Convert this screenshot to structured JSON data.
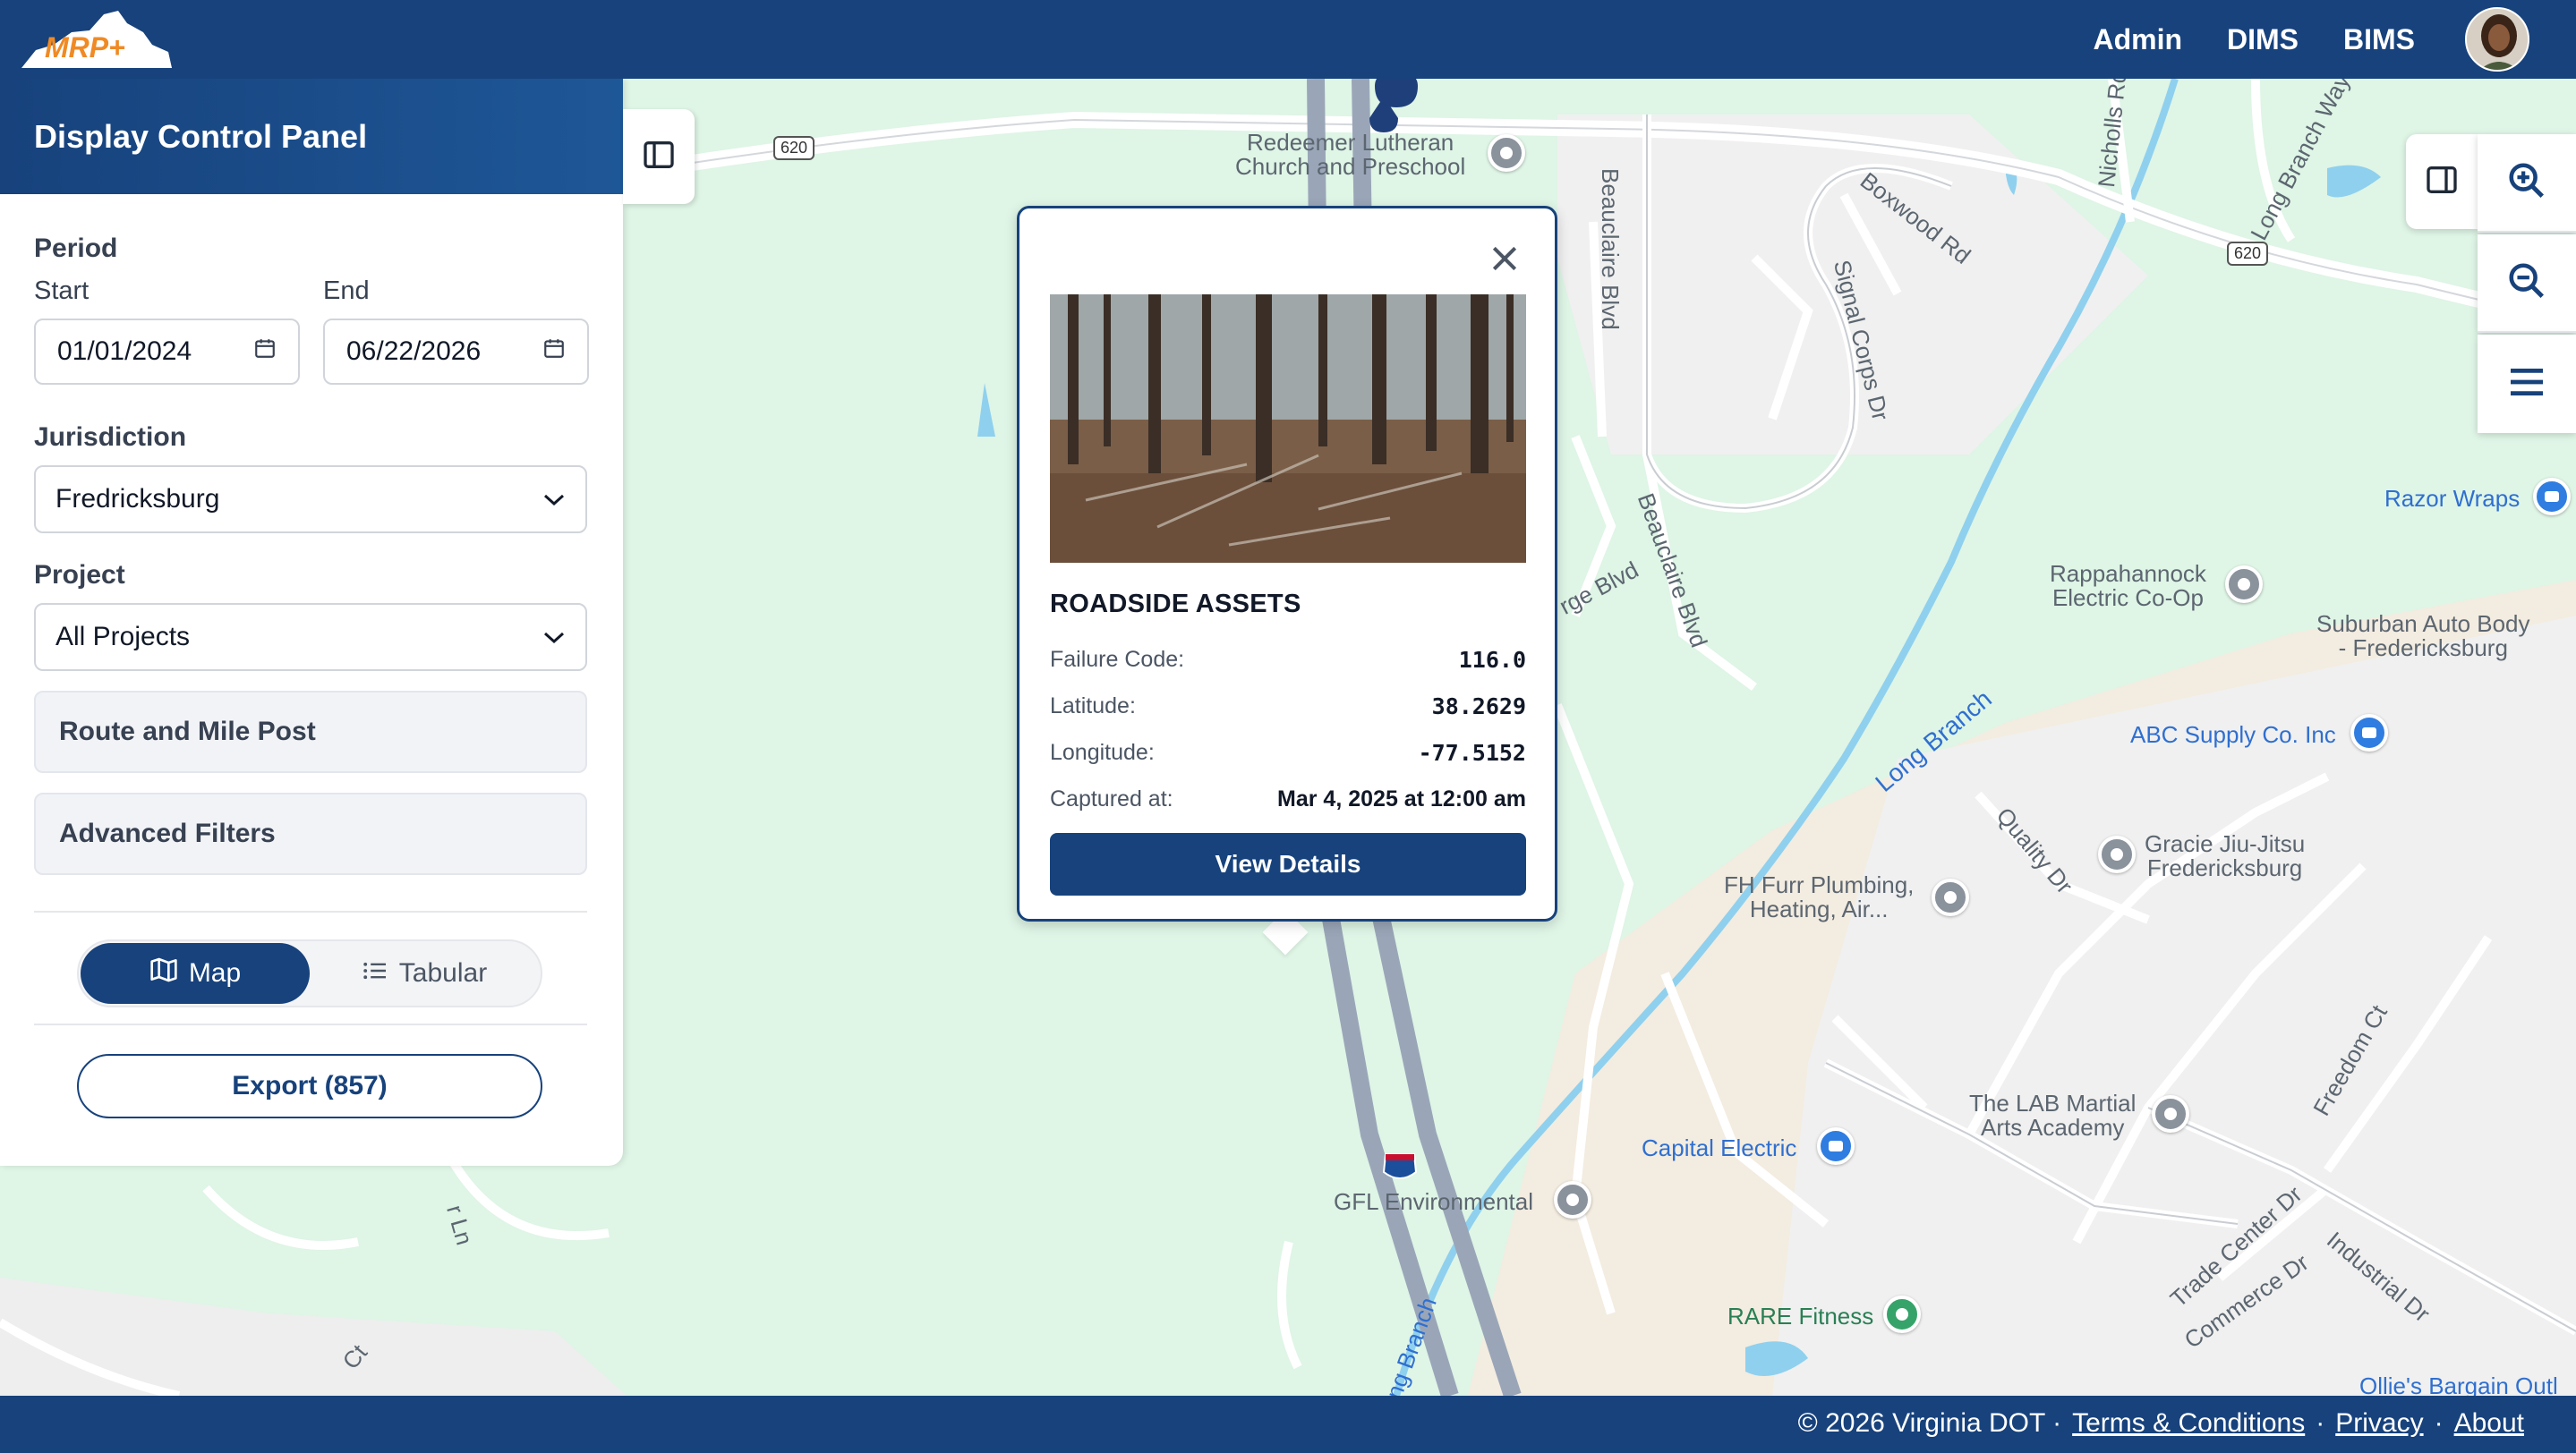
{
  "header": {
    "logo_text": "MRP+",
    "nav": [
      "Admin",
      "DIMS",
      "BIMS"
    ],
    "colors": {
      "primary": "#17427c",
      "accent": "#f08a24"
    }
  },
  "panel": {
    "title": "Display Control Panel",
    "period_label": "Period",
    "start_label": "Start",
    "start_value": "01/01/2024",
    "end_label": "End",
    "end_value": "06/22/2026",
    "jurisdiction_label": "Jurisdiction",
    "jurisdiction_value": "Fredricksburg",
    "project_label": "Project",
    "project_value": "All Projects",
    "route_label": "Route and Mile Post",
    "advanced_label": "Advanced Filters",
    "view_toggle": {
      "map": "Map",
      "tabular": "Tabular",
      "selected": "Map"
    },
    "export_label": "Export (857)"
  },
  "popup": {
    "title": "ROADSIDE ASSETS",
    "rows": [
      {
        "label": "Failure Code:",
        "value": "116.0"
      },
      {
        "label": "Latitude:",
        "value": "38.2629"
      },
      {
        "label": "Longitude:",
        "value": "-77.5152"
      },
      {
        "label": "Captured at:",
        "value": "Mar 4, 2025 at 12:00 am"
      }
    ],
    "button": "View Details"
  },
  "map": {
    "labels": {
      "church": "Redeemer Lutheran\nChurch and Preschool",
      "beauclaire_top": "Beauclaire Blvd",
      "beauclaire_mid": "Beauclaire Blvd",
      "boxwood": "Boxwood Rd",
      "signal_corps": "Signal Corps Dr",
      "nicholls": "Nicholls Rd",
      "long_branch_way": "Long Branch Way",
      "razor_wraps": "Razor Wraps",
      "rappahannock": "Rappahannock\nElectric Co-Op",
      "suburban": "Suburban Auto Body\n- Fredericksburg",
      "abc_supply": "ABC Supply Co. Inc",
      "long_branch": "Long Branch",
      "long_branch_lower": "ng Branch",
      "quality_dr": "Quality Dr",
      "gracie": "Gracie Jiu-Jitsu\nFredericksburg",
      "fh_furr": "FH Furr Plumbing,\nHeating, Air...",
      "freedom_ct": "Freedom Ct",
      "lab_martial": "The LAB Martial\nArts Academy",
      "capital_electric": "Capital Electric",
      "gfl": "GFL Environmental",
      "trade_center": "Trade Center Dr",
      "commerce": "Commerce Dr",
      "industrial": "Industrial Dr",
      "rare_fitness": "RARE Fitness",
      "ollies": "Ollie's Bargain Outl",
      "george_blvd": "rge Blvd",
      "route_620": "620",
      "i95": "95",
      "ln_left": "r Ln",
      "ct_left": "Ct"
    }
  },
  "footer": {
    "copyright": "© 2026 Virginia DOT ·",
    "terms": "Terms & Conditions",
    "privacy": "Privacy",
    "about": "About",
    "dot": "·"
  }
}
